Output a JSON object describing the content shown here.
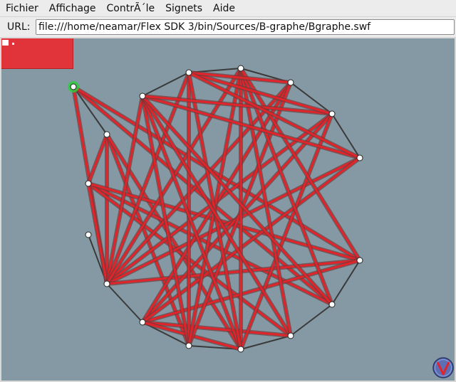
{
  "menubar": {
    "items": [
      {
        "name": "menu-fichier",
        "label": "Fichier"
      },
      {
        "name": "menu-affichage",
        "label": "Affichage"
      },
      {
        "name": "menu-controle",
        "label": "ContrÃ´le"
      },
      {
        "name": "menu-signets",
        "label": "Signets"
      },
      {
        "name": "menu-aide",
        "label": "Aide"
      }
    ]
  },
  "urlbar": {
    "label": "URL:",
    "value": "file:///home/neamar/Flex SDK 3/bin/Sources/B-graphe/Bgraphe.swf"
  },
  "colors": {
    "stage_background": "#8499a3",
    "edge_red": "#e0242a",
    "edge_dark": "#3a3a3a",
    "panel_red": "#e1343a",
    "selected_node": "#2ecc40",
    "node_fill": "#ffffff"
  },
  "icons": {
    "logo": "v-logo-icon"
  }
}
